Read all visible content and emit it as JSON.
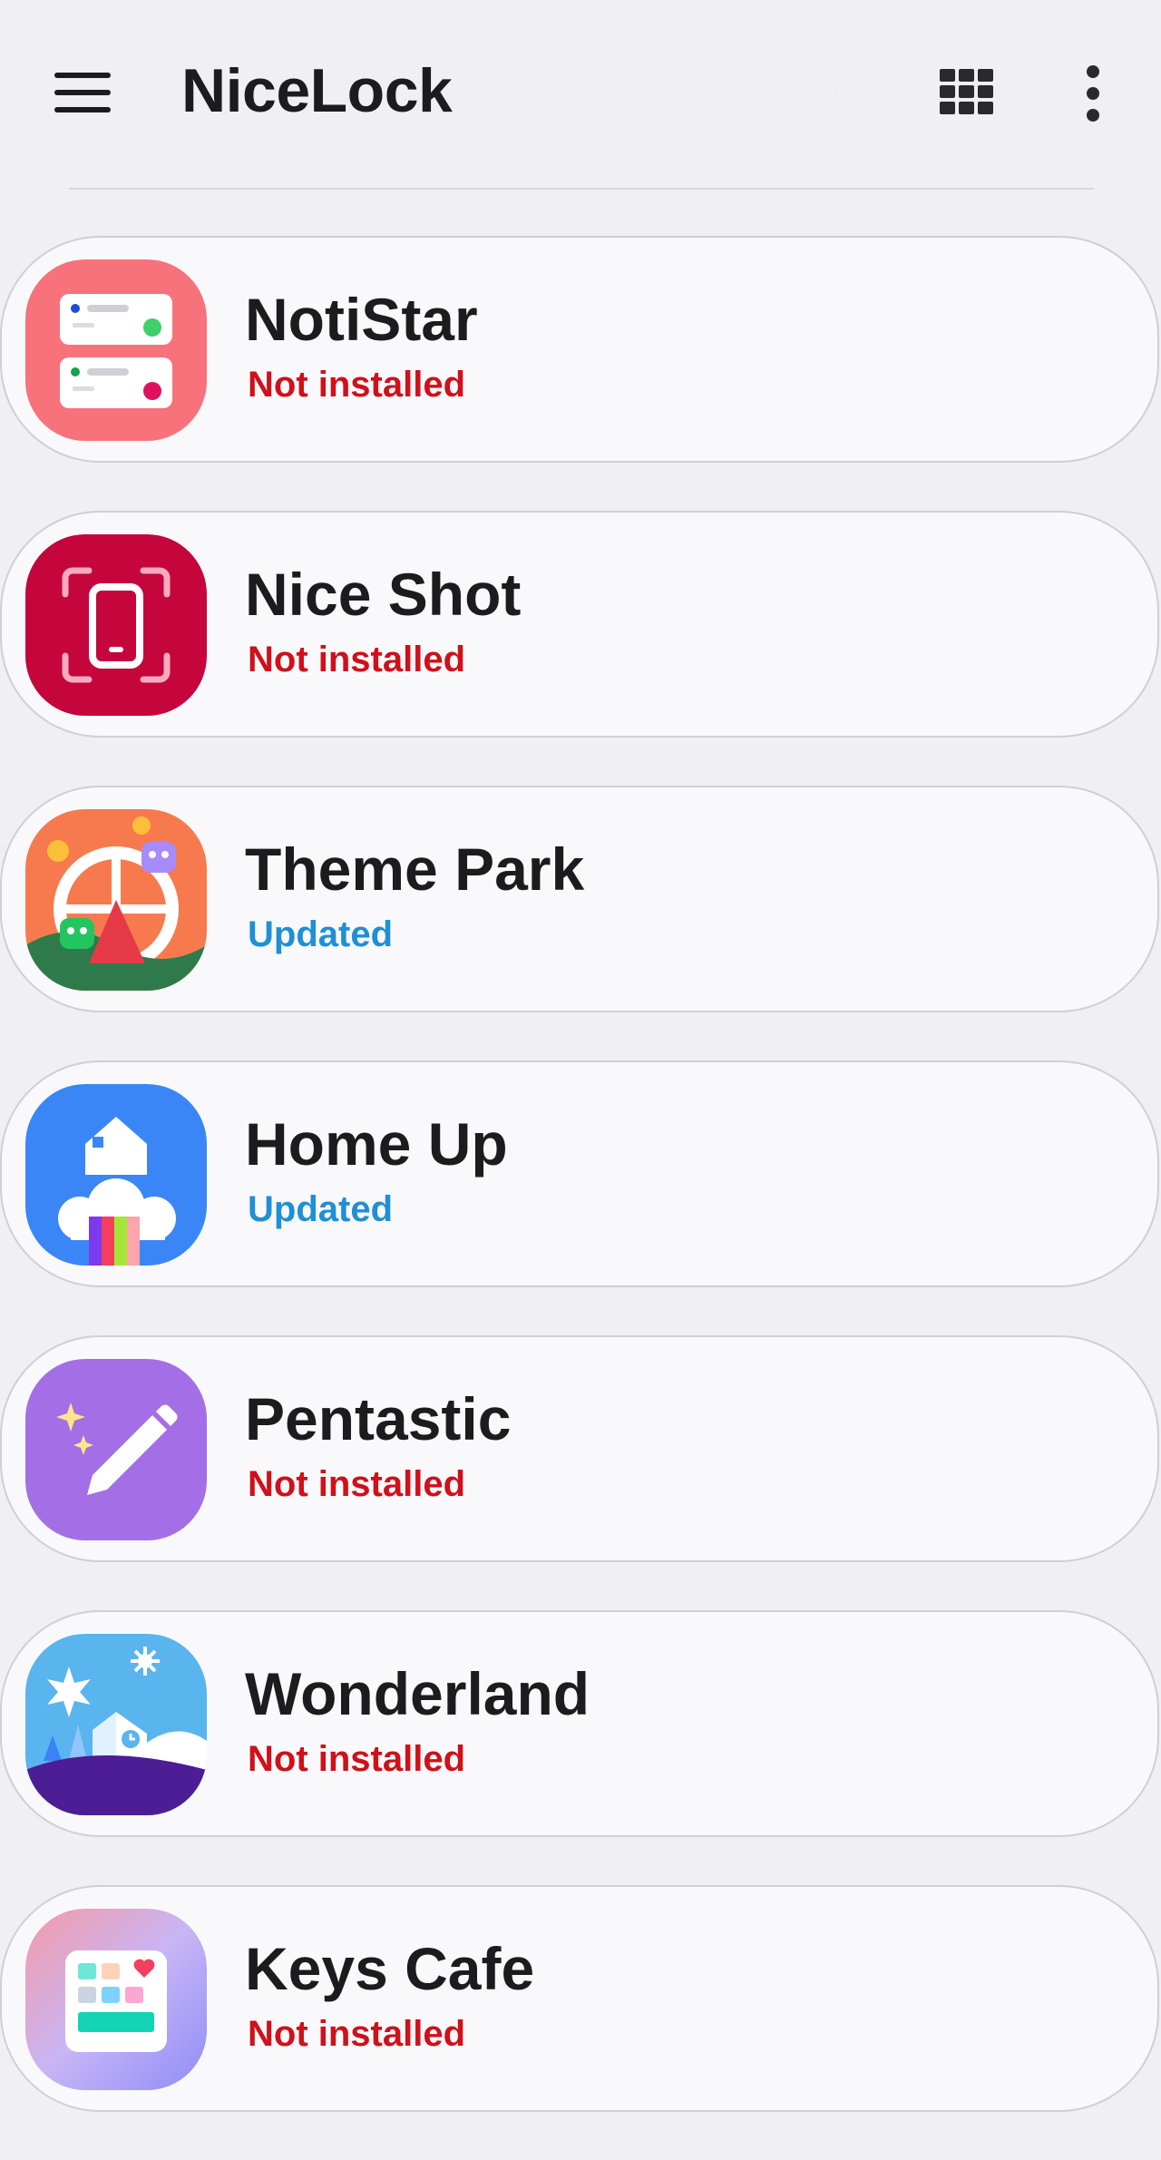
{
  "app": {
    "title": "NiceLock"
  },
  "toolbar": {
    "menu_icon": "hamburger-menu-icon",
    "theme_icon": "moon-icon",
    "layout_icon": "grid-view-icon",
    "overflow_icon": "more-vertical-icon"
  },
  "modules": [
    {
      "name": "NotiStar",
      "status": "Not installed",
      "status_type": "not_installed",
      "icon": "notistar-icon"
    },
    {
      "name": "Nice Shot",
      "status": "Not installed",
      "status_type": "not_installed",
      "icon": "nice-shot-icon"
    },
    {
      "name": "Theme Park",
      "status": "Updated",
      "status_type": "updated",
      "icon": "theme-park-icon"
    },
    {
      "name": "Home Up",
      "status": "Updated",
      "status_type": "updated",
      "icon": "home-up-icon"
    },
    {
      "name": "Pentastic",
      "status": "Not installed",
      "status_type": "not_installed",
      "icon": "pentastic-icon"
    },
    {
      "name": "Wonderland",
      "status": "Not installed",
      "status_type": "not_installed",
      "icon": "wonderland-icon"
    },
    {
      "name": "Keys Cafe",
      "status": "Not installed",
      "status_type": "not_installed",
      "icon": "keys-cafe-icon"
    }
  ],
  "colors": {
    "background": "#f0f0f4",
    "card": "#f9f9fb",
    "not_installed": "#d0101a",
    "updated": "#1f8fd6"
  }
}
